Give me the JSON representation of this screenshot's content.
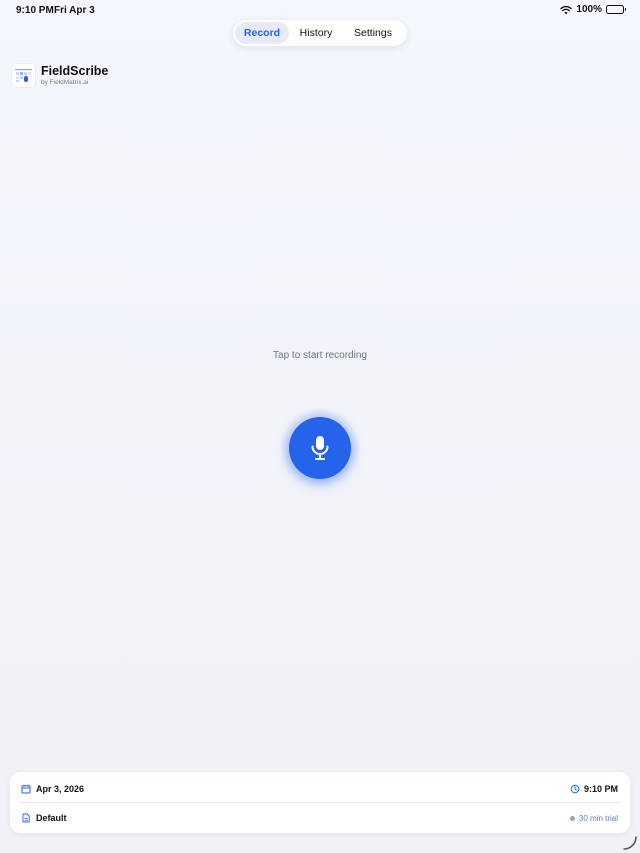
{
  "status_bar": {
    "time": "9:10 PM",
    "date": "Fri Apr 3",
    "battery": "100%"
  },
  "tabs": [
    {
      "label": "Record",
      "active": true
    },
    {
      "label": "History",
      "active": false
    },
    {
      "label": "Settings",
      "active": false
    }
  ],
  "brand": {
    "name": "FieldScribe",
    "subtitle": "by FieldMatrix.ai"
  },
  "main": {
    "prompt": "Tap to start recording",
    "mic_icon": "microphone-icon"
  },
  "session": {
    "date": "Apr 3, 2026",
    "time": "9:10 PM",
    "template": "Default",
    "trial": "30 min trial"
  },
  "colors": {
    "accent": "#2563eb",
    "background": "#f3f5fb"
  }
}
